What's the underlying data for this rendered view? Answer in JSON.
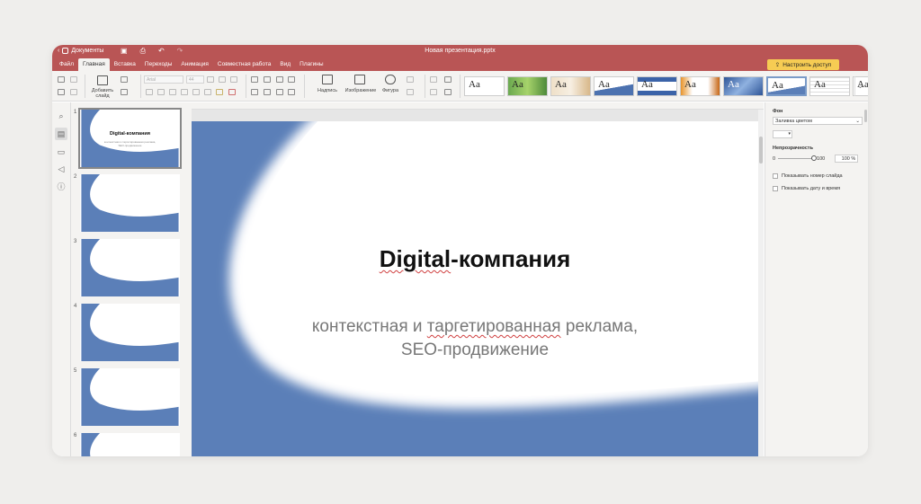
{
  "titlebar": {
    "back_label": "Документы",
    "doc_title": "Новая презентация.pptx"
  },
  "menu": {
    "tabs": [
      "Файл",
      "Главная",
      "Вставка",
      "Переходы",
      "Анимация",
      "Совместная работа",
      "Вид",
      "Плагины"
    ],
    "active_tab": "Главная",
    "share_button": "Настроить доступ"
  },
  "toolbar": {
    "add_slide_label_1": "Добавить",
    "add_slide_label_2": "слайд",
    "font_name": "Arial",
    "font_size": "44",
    "caption_label": "Надпись",
    "image_label": "Изображение",
    "shape_label": "Фигура",
    "theme_sample": "Aa"
  },
  "slides": [
    {
      "number": "1"
    },
    {
      "number": "2"
    },
    {
      "number": "3"
    },
    {
      "number": "4"
    },
    {
      "number": "5"
    },
    {
      "number": "6"
    }
  ],
  "slide": {
    "title_part1": "Digital",
    "title_part2": "-компания",
    "subtitle_1a": "контекстная и ",
    "subtitle_1b": "таргетированная",
    "subtitle_1c": " реклама,",
    "subtitle_2": "SEO-продвижение",
    "thumb_title": "Digital-компания",
    "thumb_sub_1": "контекстная и таргетированная реклама,",
    "thumb_sub_2": "SEO-продвижение",
    "accent_color": "#5b7fb8"
  },
  "right_panel": {
    "background_label": "Фон",
    "fill_select": "Заливка цветом",
    "opacity_label": "Непрозрачность",
    "slider_min": "0",
    "slider_max": "100",
    "opacity_value": "100 %",
    "show_slide_number": "Показывать номер слайда",
    "show_date_time": "Показывать дату и время"
  },
  "colors": {
    "header": "#b95555",
    "share_button": "#f6cc53"
  }
}
